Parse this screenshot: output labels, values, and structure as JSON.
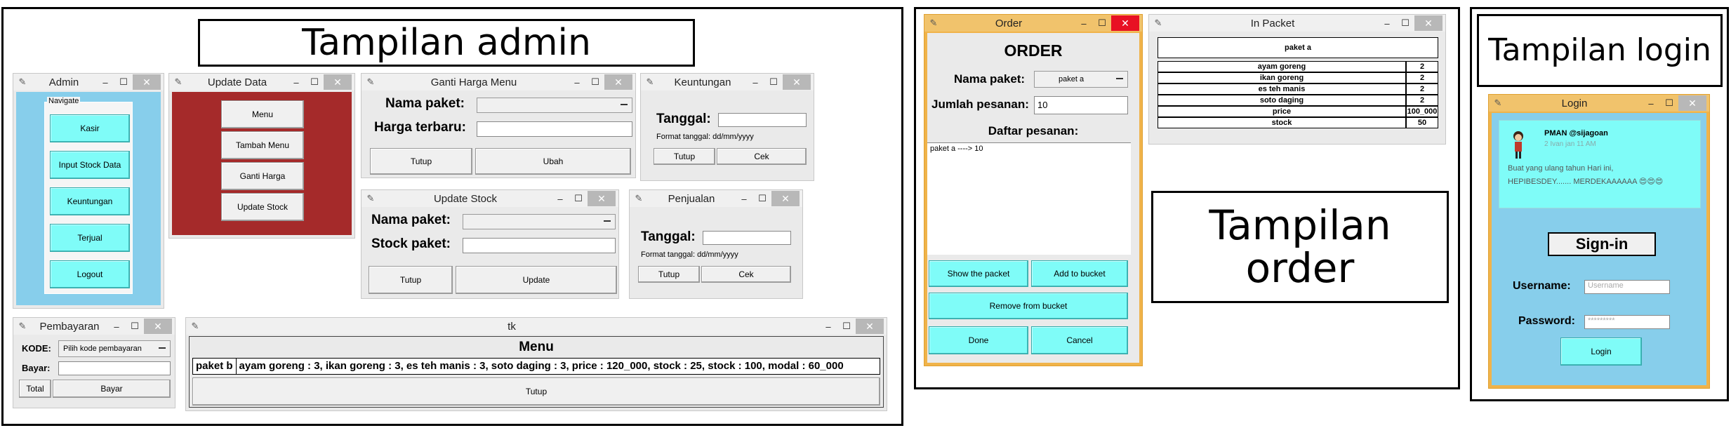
{
  "admin_section": {
    "heading": "Tampilan admin",
    "admin_window": {
      "title": "Admin",
      "group_label": "Navigate",
      "buttons": [
        "Kasir",
        "Input Stock Data",
        "Keuntungan",
        "Terjual",
        "Logout"
      ]
    },
    "update_data_window": {
      "title": "Update Data",
      "buttons": [
        "Menu",
        "Tambah Menu",
        "Ganti Harga",
        "Update Stock"
      ]
    },
    "ganti_harga_window": {
      "title": "Ganti Harga Menu",
      "paket_label": "Nama paket:",
      "harga_label": "Harga terbaru:",
      "paket_value": "",
      "harga_value": "",
      "tutup_label": "Tutup",
      "ubah_label": "Ubah"
    },
    "keuntungan_window": {
      "title": "Keuntungan",
      "tanggal_label": "Tanggal:",
      "tanggal_value": "",
      "format_hint": "Format tanggal: dd/mm/yyyy",
      "tutup_label": "Tutup",
      "cek_label": "Cek"
    },
    "update_stock_window": {
      "title": "Update Stock",
      "paket_label": "Nama paket:",
      "stock_label": "Stock paket:",
      "paket_value": "",
      "stock_value": "",
      "tutup_label": "Tutup",
      "update_label": "Update"
    },
    "penjualan_window": {
      "title": "Penjualan",
      "tanggal_label": "Tanggal:",
      "tanggal_value": "",
      "format_hint": "Format tanggal: dd/mm/yyyy",
      "tutup_label": "Tutup",
      "cek_label": "Cek"
    },
    "pembayaran_window": {
      "title": "Pembayaran",
      "kode_label": "KODE:",
      "kode_value": "Pilih kode pembayaran",
      "bayar_label": "Bayar:",
      "bayar_value": "",
      "total_label": "Total",
      "bayar_button": "Bayar"
    },
    "tk_window": {
      "title": "tk",
      "menu_heading": "Menu",
      "row_label": "paket b",
      "row_detail": "ayam goreng : 3, ikan goreng : 3, es teh manis : 3, soto daging : 3, price : 120_000, stock : 25, stock : 100, modal : 60_000",
      "tutup_label": "Tutup"
    }
  },
  "order_section": {
    "heading": "Tampilan order",
    "order_window": {
      "title": "Order",
      "heading": "ORDER",
      "paket_label": "Nama paket:",
      "paket_value": "paket a",
      "jumlah_label": "Jumlah pesanan:",
      "jumlah_value": "10",
      "daftar_label": "Daftar pesanan:",
      "daftar_text": "paket a ----> 10",
      "show_label": "Show the packet",
      "add_label": "Add to bucket",
      "remove_label": "Remove from bucket",
      "done_label": "Done",
      "cancel_label": "Cancel"
    },
    "in_packet_window": {
      "title": "In Packet",
      "table_title": "paket a",
      "rows": [
        {
          "item": "ayam goreng",
          "qty": "2"
        },
        {
          "item": "ikan goreng",
          "qty": "2"
        },
        {
          "item": "es teh manis",
          "qty": "2"
        },
        {
          "item": "soto daging",
          "qty": "2"
        },
        {
          "item": "price",
          "qty": "100_000"
        },
        {
          "item": "stock",
          "qty": "50"
        }
      ]
    }
  },
  "login_section": {
    "heading": "Tampilan login",
    "login_window": {
      "title": "Login",
      "tweet_name": "PMAN @sijagoan",
      "tweet_time": "2 Ivan jan 11 AM",
      "tweet_text_1": "Buat yang ulang tahun Hari ini,",
      "tweet_text_2": "HEPIBESDEY....... MERDEKAAAAAA 😍😍😍",
      "signin_label": "Sign-in",
      "username_label": "Username:",
      "username_placeholder": "Username",
      "password_label": "Password:",
      "password_value": "*********",
      "login_label": "Login"
    }
  },
  "window_controls": {
    "minimize": "–",
    "maximize": "☐",
    "close": "✕",
    "app_icon": "✎"
  },
  "colors": {
    "admin_blue": "#87ceeb",
    "update_red": "#a52a2a",
    "cyan_button": "#7ffcf8",
    "login_blue": "#87ceeb",
    "order_border": "#f0b34a"
  }
}
